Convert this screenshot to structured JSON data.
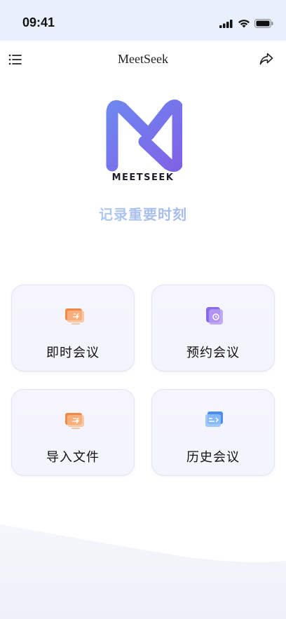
{
  "status_bar": {
    "time": "09:41"
  },
  "nav": {
    "title": "MeetSeek"
  },
  "brand": {
    "wordmark": "MEETSEEK",
    "tagline": "记录重要时刻",
    "logo_colors": [
      "#6f86f0",
      "#7f63e6"
    ]
  },
  "actions": [
    {
      "label": "即时会议",
      "icon": "instant-meeting-icon",
      "color": "#f08a4b"
    },
    {
      "label": "预约会议",
      "icon": "schedule-meeting-icon",
      "color": "#8b68e8"
    },
    {
      "label": "导入文件",
      "icon": "import-file-icon",
      "color": "#f08a4b"
    },
    {
      "label": "历史会议",
      "icon": "history-meeting-icon",
      "color": "#4a8ff0"
    }
  ]
}
